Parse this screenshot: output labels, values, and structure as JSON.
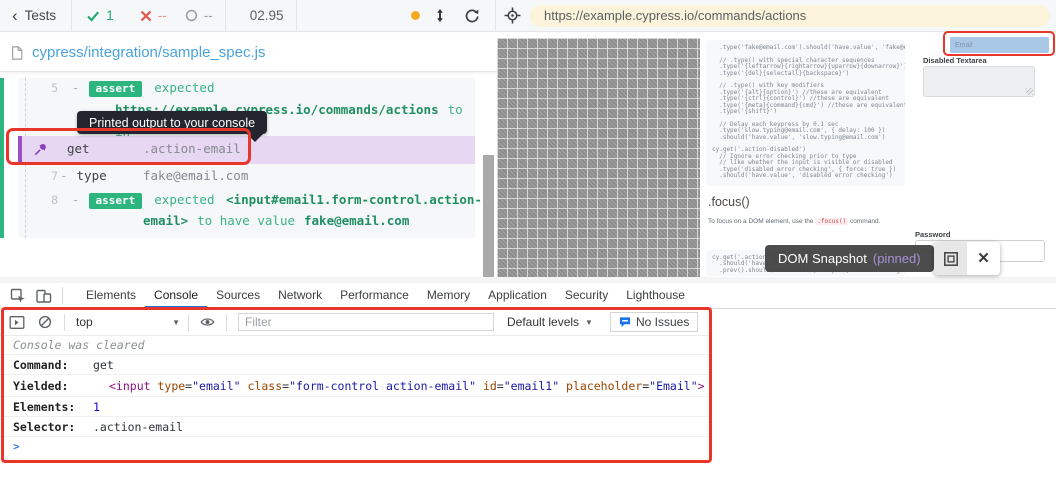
{
  "colors": {
    "pass_green": "#24a971",
    "fail_red": "#e6564d",
    "pin_purple": "#9a4fc9",
    "annotation_red": "#e8362a",
    "active_tab_blue": "#1a73e8",
    "spec_blue": "#4aa3dc",
    "url_pill_cream": "#fbf3da",
    "pinned_row_purple": "#e7d7f2"
  },
  "runner": {
    "back_label": "Tests",
    "stats": {
      "passed": "1",
      "failed": "--",
      "pending": "--",
      "duration": "02.95"
    },
    "url": "https://example.cypress.io/commands/actions"
  },
  "reporter": {
    "spec_path": "cypress/integration/sample_spec.js",
    "tooltip": "Printed output to your console",
    "rows": {
      "assert5": {
        "num": "5",
        "dash": "-",
        "badge": "assert",
        "word": "expected",
        "url": "https://example.cypress.io/commands/actions",
        "to": "to",
        "rest": "in"
      },
      "get": {
        "method": "get",
        "args": ".action-email"
      },
      "type": {
        "num": "7",
        "dash": "-",
        "method": "type",
        "args": "fake@email.com"
      },
      "assert8": {
        "num": "8",
        "dash": "-",
        "badge": "assert",
        "word": "expected",
        "tag_line1": "<input#email1.form-control.action-",
        "tag_line2": "email>",
        "mid": "to have value",
        "value": "fake@email.com"
      }
    }
  },
  "snapshot": {
    "label": "DOM Snapshot",
    "pinned": "(pinned)"
  },
  "app_page": {
    "code_block_1": [
      "  .type('fake@email.com').should('have.value', 'fake@email.com')",
      "",
      "  // .type() with special character sequences",
      "  .type('{leftarrow}{rightarrow}{uparrow}{downarrow}')",
      "  .type('{del}{selectall}{backspace}')",
      "",
      "  // .type() with key modifiers",
      "  .type('{alt}{option}') //these are equivalent",
      "  .type('{ctrl}{control}') //these are equivalent",
      "  .type('{meta}{command}{cmd}') //these are equivalent",
      "  .type('{shift}')",
      "",
      "  // Delay each keypress by 0.1 sec",
      "  .type('slow.typing@email.com', { delay: 100 })",
      "  .should('have.value', 'slow.typing@email.com')",
      "",
      "cy.get('.action-disabled')",
      "  // Ignore error checking prior to type",
      "  // like whether the input is visible or disabled",
      "  .type('disabled error checking', { force: true })",
      "  .should('have.value', 'disabled error checking')"
    ],
    "focus_heading": ".focus()",
    "focus_text_before": "To focus on a DOM element, use the ",
    "focus_chip": ".focus()",
    "focus_text_after": " command.",
    "code_block_2": [
      "cy.get('.action-focus').focus()",
      "  .should('have.class', 'focus')",
      "  .prev().should('have.attr', 'style', 'color: orange;')"
    ],
    "email_input_value": "Email",
    "disabled_textarea_label": "Disabled Textarea",
    "password_label": "Password",
    "password_placeholder": "Password"
  },
  "devtools": {
    "tabs": [
      {
        "label": "Elements"
      },
      {
        "label": "Console",
        "cls": "active"
      },
      {
        "label": "Sources"
      },
      {
        "label": "Network"
      },
      {
        "label": "Performance"
      },
      {
        "label": "Memory"
      },
      {
        "label": "Application"
      },
      {
        "label": "Security"
      },
      {
        "label": "Lighthouse"
      }
    ],
    "toolbar": {
      "context": "top",
      "filter_placeholder": "Filter",
      "levels_label": "Default levels",
      "no_issues_label": "No Issues"
    },
    "console": {
      "cleared": "Console was cleared",
      "command_label": "Command:",
      "command_value": "get",
      "yielded_label": "Yielded:",
      "yielded_tokens": [
        {
          "t": "<input ",
          "c": "tag"
        },
        {
          "t": "type",
          "c": "attr"
        },
        {
          "t": "=",
          "c": "plain"
        },
        {
          "t": "\"email\" ",
          "c": "val"
        },
        {
          "t": "class",
          "c": "attr"
        },
        {
          "t": "=",
          "c": "plain"
        },
        {
          "t": "\"form-control action-email\" ",
          "c": "val"
        },
        {
          "t": "id",
          "c": "attr"
        },
        {
          "t": "=",
          "c": "plain"
        },
        {
          "t": "\"email1\" ",
          "c": "val"
        },
        {
          "t": "placeholder",
          "c": "attr"
        },
        {
          "t": "=",
          "c": "plain"
        },
        {
          "t": "\"Email\"",
          "c": "val"
        },
        {
          "t": ">",
          "c": "tag"
        }
      ],
      "elements_label": "Elements:",
      "elements_value": "1",
      "selector_label": "Selector:",
      "selector_value": ".action-email",
      "prompt": ">"
    }
  }
}
